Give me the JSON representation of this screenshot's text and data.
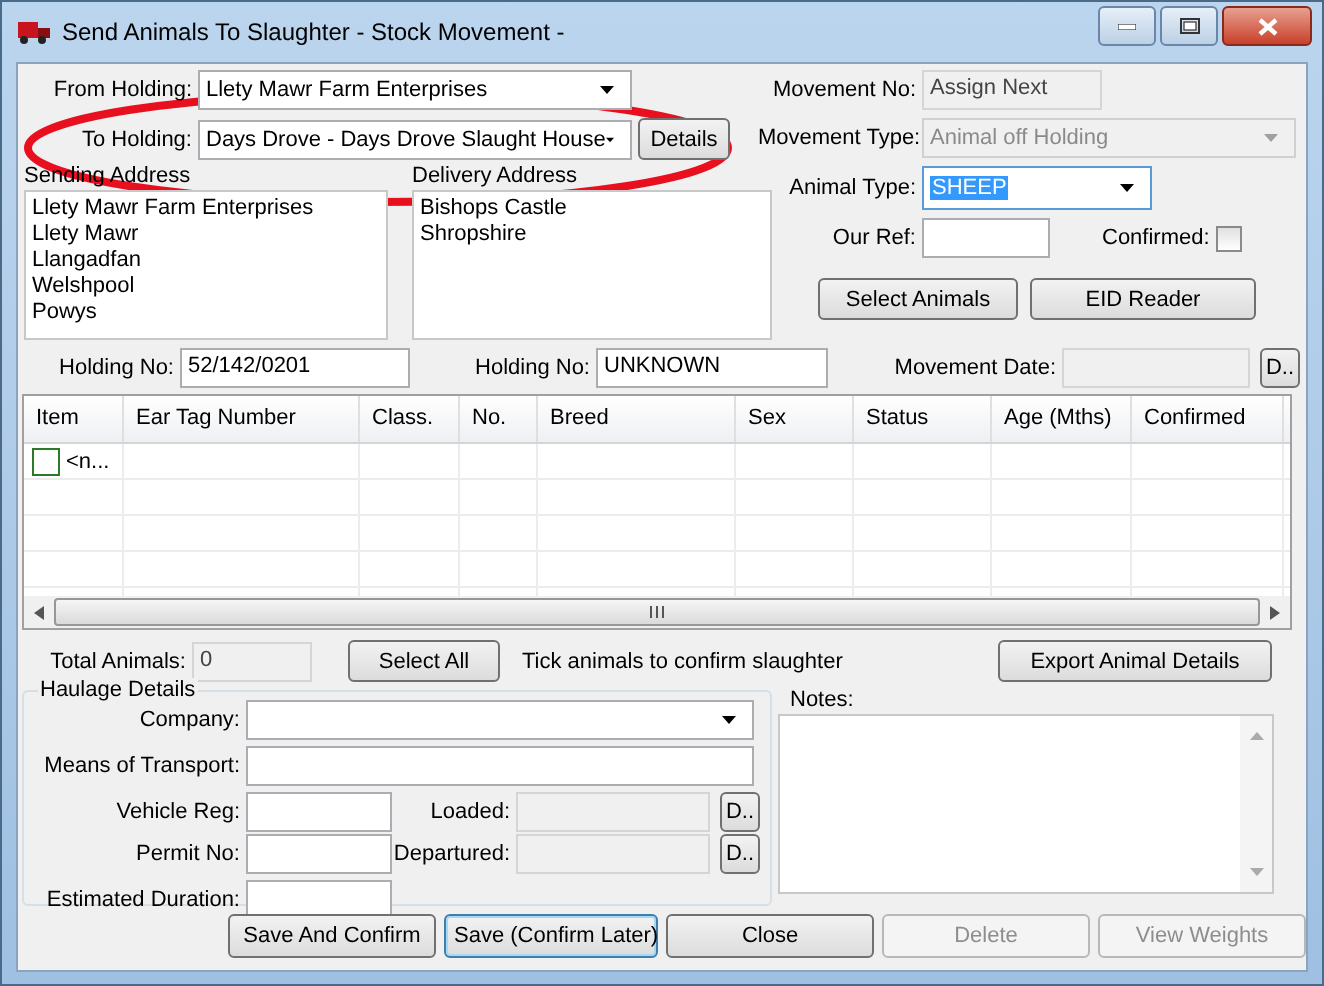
{
  "window": {
    "title": "Send Animals To Slaughter - Stock Movement -"
  },
  "from_holding": {
    "label": "From Holding:",
    "value": "Llety Mawr Farm Enterprises"
  },
  "to_holding": {
    "label": "To Holding:",
    "value": "Days Drove - Days Drove Slaught House",
    "button": "Details"
  },
  "sending_address": {
    "label": "Sending Address",
    "lines": [
      "Llety Mawr Farm Enterprises",
      "Llety Mawr",
      "Llangadfan",
      "Welshpool",
      "Powys"
    ]
  },
  "delivery_address": {
    "label": "Delivery Address",
    "lines": [
      "Bishops Castle",
      "Shropshire"
    ]
  },
  "movement_no": {
    "label": "Movement No:",
    "value": "Assign Next",
    "disabled": true
  },
  "movement_type": {
    "label": "Movement Type:",
    "value": "Animal off Holding",
    "disabled": true
  },
  "animal_type": {
    "label": "Animal Type:",
    "value": "SHEEP",
    "selected": true
  },
  "our_ref": {
    "label": "Our Ref:"
  },
  "confirmed": {
    "label": "Confirmed:",
    "checked": false
  },
  "top_buttons": [
    "Select Animals",
    "EID Reader"
  ],
  "sending_holding_no": {
    "label": "Holding No:",
    "value": "52/142/0201"
  },
  "delivery_holding_no": {
    "label": "Holding No:",
    "value": "UNKNOWN"
  },
  "movement_date": {
    "label": "Movement Date:",
    "button": "D.."
  },
  "table": {
    "columns": [
      "Item",
      "Ear Tag Number",
      "Class.",
      "No.",
      "Breed",
      "Sex",
      "Status",
      "Age (Mths)",
      "Confirmed"
    ],
    "rows": [
      {
        "checked": false,
        "item": "<n..."
      }
    ]
  },
  "total_animals": {
    "label": "Total Animals:",
    "value": "0"
  },
  "select_all": "Select All",
  "hint": "Tick animals to confirm slaughter",
  "export_button": "Export Animal Details",
  "haulage": {
    "title": "Haulage Details",
    "company": "Company:",
    "transport": "Means of Transport:",
    "vehicle_reg": "Vehicle Reg:",
    "permit_no": "Permit No:",
    "duration": "Estimated Duration:",
    "loaded": {
      "label": "Loaded:",
      "button": "D.."
    },
    "departured": {
      "label": "Departured:",
      "button": "D.."
    }
  },
  "notes": {
    "label": "Notes:"
  },
  "buttons": [
    {
      "label": "Save And Confirm",
      "disabled": false,
      "focused": false
    },
    {
      "label": "Save (Confirm Later)",
      "disabled": false,
      "focused": true
    },
    {
      "label": "Close",
      "disabled": false,
      "focused": false
    },
    {
      "label": "Delete",
      "disabled": true,
      "focused": false
    },
    {
      "label": "View Weights",
      "disabled": true,
      "focused": false
    }
  ],
  "annotation": {
    "kind": "ellipse"
  }
}
